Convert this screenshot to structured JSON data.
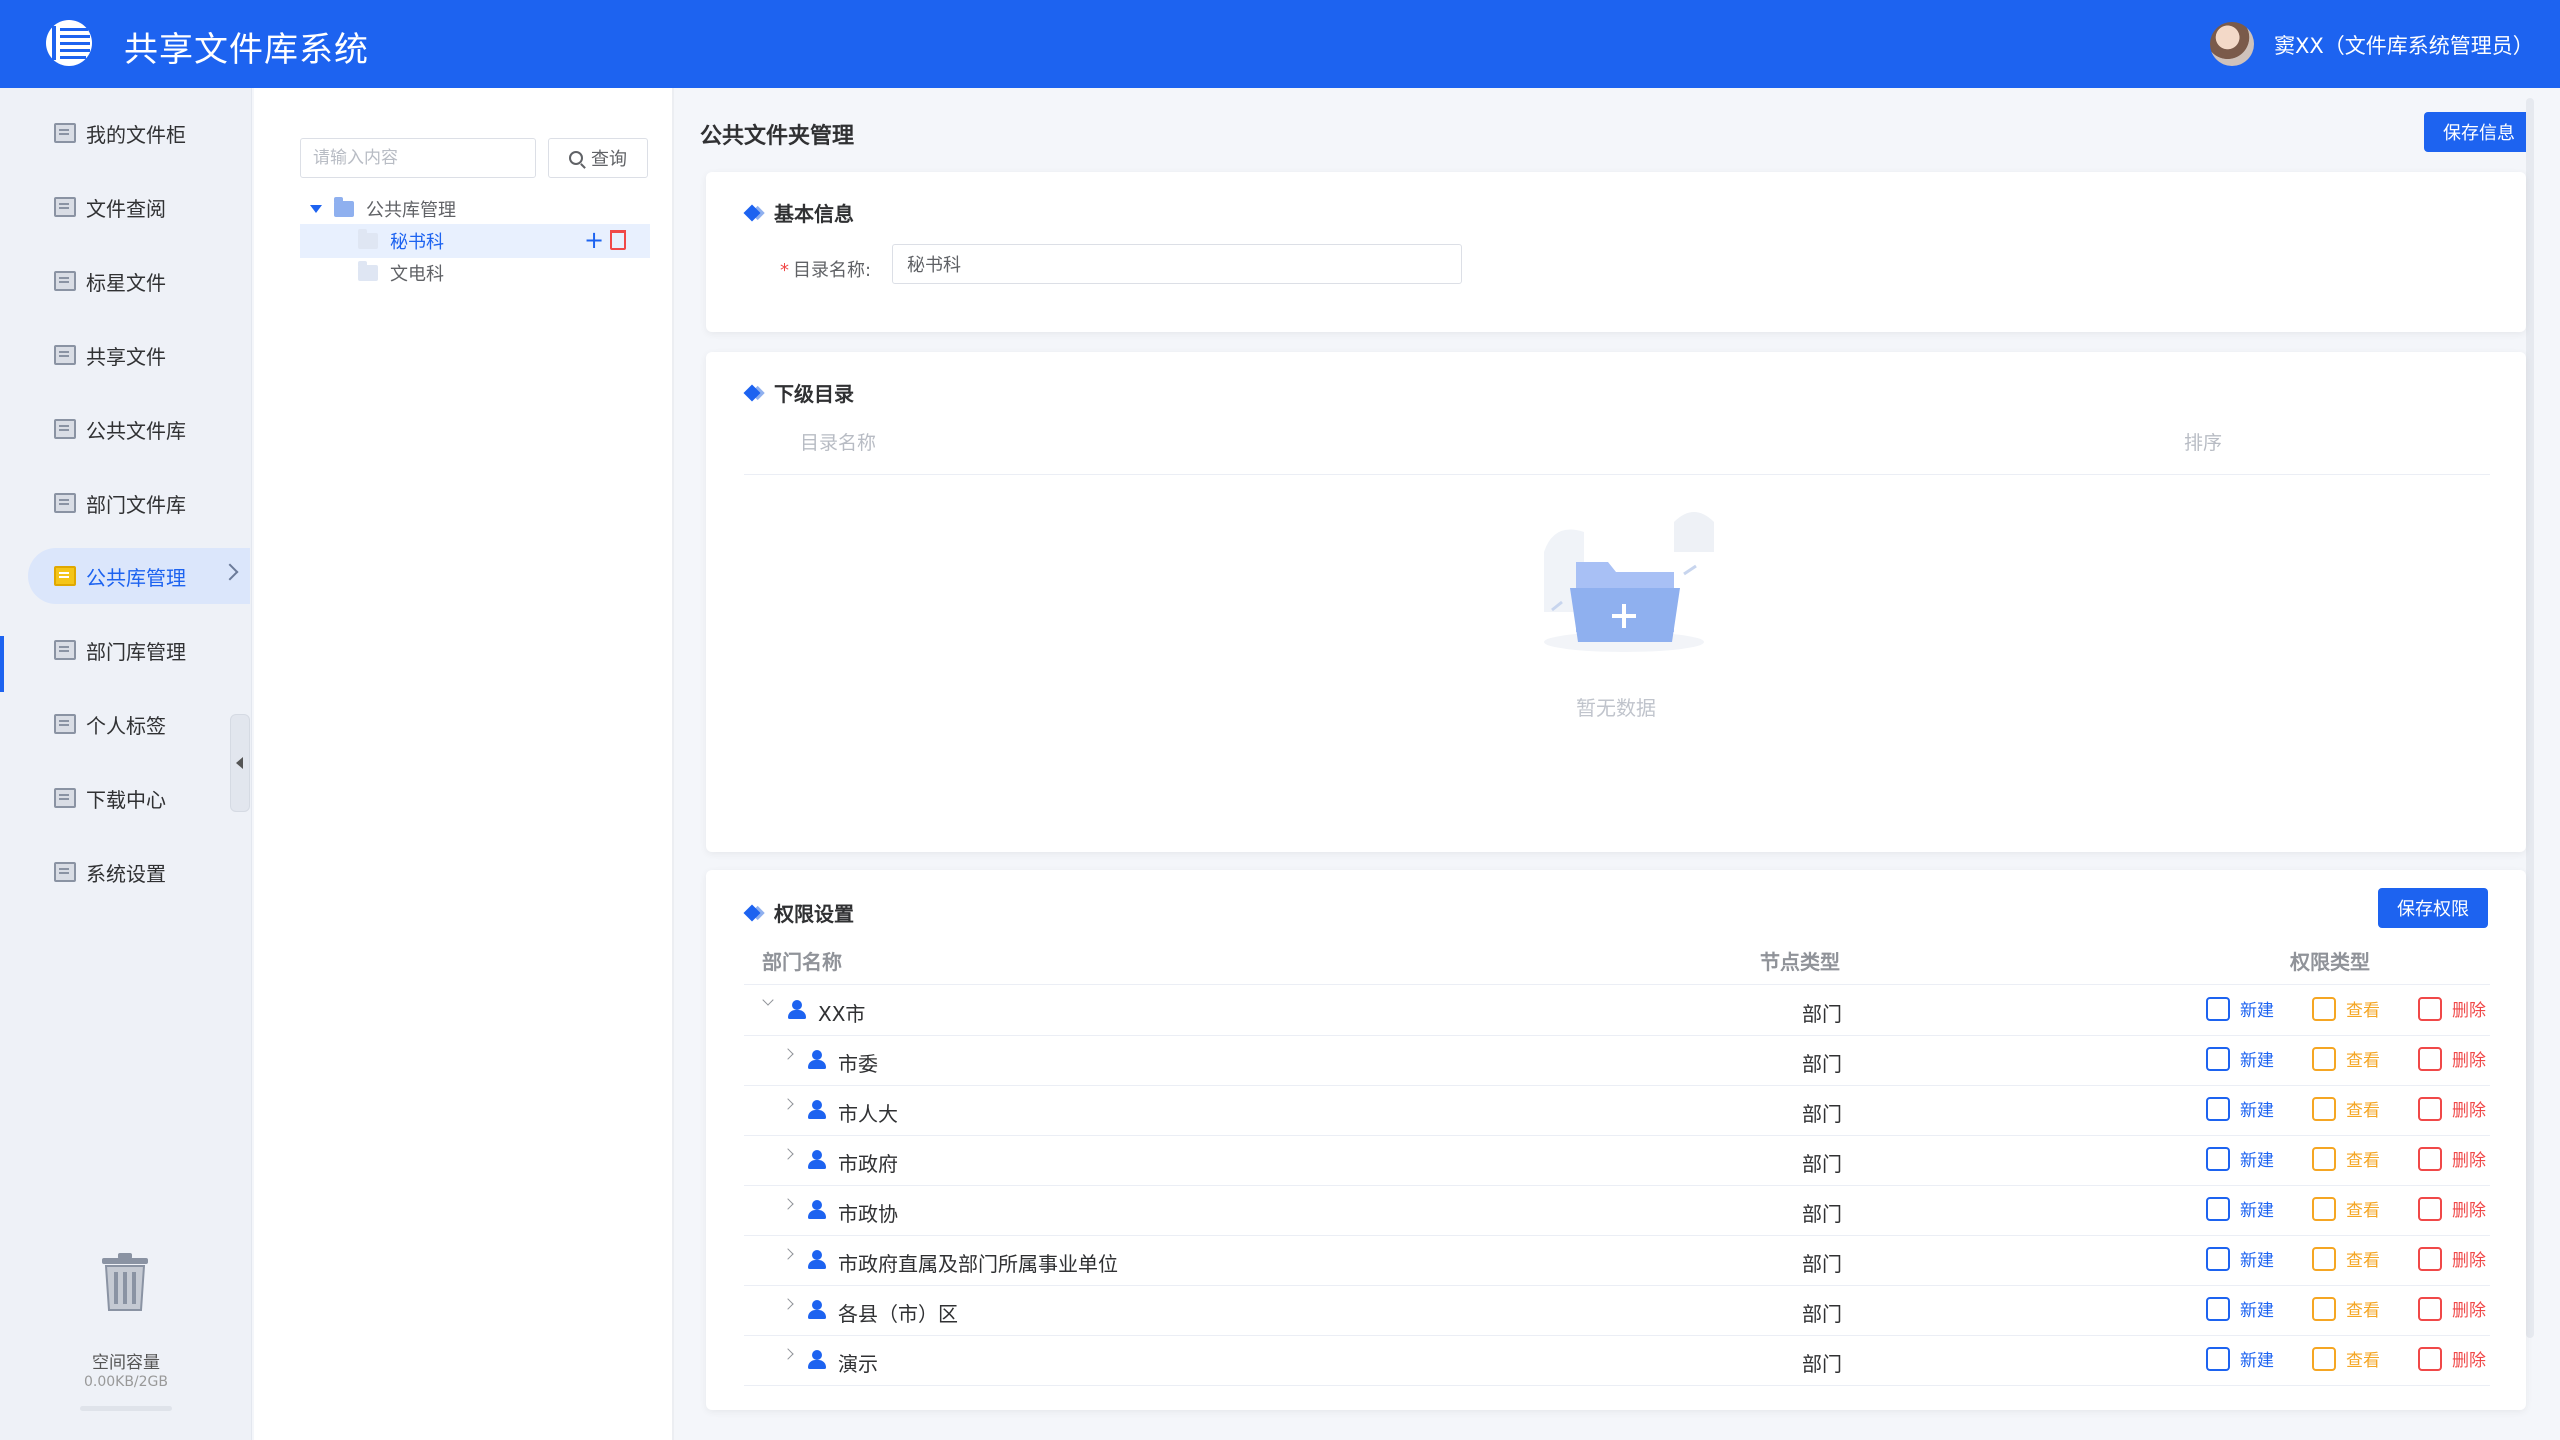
{
  "header": {
    "app_title": "共享文件库系统",
    "user_label": "窦XX（文件库系统管理员）"
  },
  "sidebar": {
    "items": [
      {
        "label": "我的文件柜"
      },
      {
        "label": "文件查阅"
      },
      {
        "label": "标星文件"
      },
      {
        "label": "共享文件"
      },
      {
        "label": "公共文件库"
      },
      {
        "label": "部门文件库"
      },
      {
        "label": "公共库管理"
      },
      {
        "label": "部门库管理"
      },
      {
        "label": "个人标签"
      },
      {
        "label": "下载中心"
      },
      {
        "label": "系统设置"
      }
    ],
    "active_index": 6,
    "space_label": "空间容量",
    "space_value": "0.00KB/2GB",
    "space_used_fraction": 0
  },
  "tree": {
    "search_placeholder": "请输入内容",
    "search_button": "查询",
    "root": "公共库管理",
    "children": [
      "秘书科",
      "文电科"
    ],
    "selected": "秘书科"
  },
  "main": {
    "title": "公共文件夹管理",
    "save_info_button": "保存信息",
    "basic": {
      "title": "基本信息",
      "name_label": "目录名称:",
      "name_value": "秘书科"
    },
    "subdir": {
      "title": "下级目录",
      "col_name": "目录名称",
      "col_order": "排序",
      "empty_text": "暂无数据"
    },
    "perm": {
      "title": "权限设置",
      "save_button": "保存权限",
      "col_dept": "部门名称",
      "col_type": "节点类型",
      "col_perm": "权限类型",
      "new_label": "新建",
      "view_label": "查看",
      "del_label": "删除",
      "rows": [
        {
          "name": "XX市",
          "type": "部门"
        },
        {
          "name": "市委",
          "type": "部门"
        },
        {
          "name": "市人大",
          "type": "部门"
        },
        {
          "name": "市政府",
          "type": "部门"
        },
        {
          "name": "市政协",
          "type": "部门"
        },
        {
          "name": "市政府直属及部门所属事业单位",
          "type": "部门"
        },
        {
          "name": "各县（市）区",
          "type": "部门"
        },
        {
          "name": "演示",
          "type": "部门"
        }
      ]
    }
  },
  "colors": {
    "primary": "#1d63f0",
    "view": "#f5a623",
    "delete": "#f04848"
  }
}
